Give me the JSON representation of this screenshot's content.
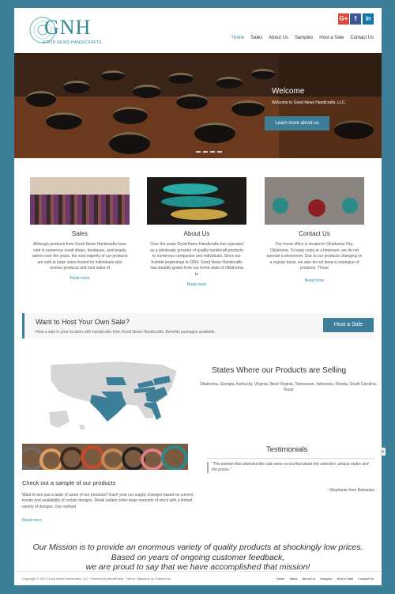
{
  "brand": {
    "logo_text": "GNH",
    "tagline": "GOOD NEWS HANDICRAFTS"
  },
  "social": [
    {
      "icon": "google-plus-icon",
      "glyph": "G+"
    },
    {
      "icon": "facebook-icon",
      "glyph": "f"
    },
    {
      "icon": "linkedin-icon",
      "glyph": "in"
    }
  ],
  "nav": [
    "Home",
    "Sales",
    "About Us",
    "Samples",
    "Host a Sale",
    "Contact Us"
  ],
  "nav_active": "Home",
  "hero": {
    "title": "Welcome",
    "subtitle": "Welcome to Good News Handicrafts, LLC.",
    "button": "Learn more about us"
  },
  "features": [
    {
      "title": "Sales",
      "text": "Although products from Good News Handicrafts have sold in numerous small shops, boutiques, and beauty salons over the years, the vast majority of our products are sold at large sales hosted by individuals who receive products and host sales of",
      "more": "Read more"
    },
    {
      "title": "About Us",
      "text": "Over the years Good News Handicrafts has operated as a wholesale provider of quality handicraft products to numerous companies and individuals.  Since our humble beginnings in 2004, Good News Handicrafts has steadily grown from our home state of Oklahoma to",
      "more": "Read more"
    },
    {
      "title": "Contact Us",
      "text": "Our home office is located in Oklahoma City, Oklahoma.  To keep costs at a minimum, we do not operate a showroom.  Due to our products changing on a regular basis, we also do not keep a catalogue of products.  Those",
      "more": "Read more"
    }
  ],
  "cta": {
    "title": "Want to Host Your Own Sale?",
    "text": "Host a sale in your location with handicrafts from Good News Handicrafts. Benefits packages available.",
    "button": "Host a Sale"
  },
  "states": {
    "title": "States Where our Products are Selling",
    "list": "Oklahoma, Georgia, Kentucky, Virginia, West Virginia, Tennessee, Nebraska, Florida, South Carolina, Texas"
  },
  "sample": {
    "title": "Check out a sample of our products",
    "text": "Want to see just a taste of some of our products?  Each year our supply changes based on current trends and availability of certain designs.  Retail outlets order large amounts of stock with a limited variety of designs.  Our method",
    "more": "Read more"
  },
  "testimonials": {
    "title": "Testimonials",
    "quote": "\"The women that attended the sale were so excited about the selection, unique styles and the prices.\"",
    "author": "~ Stephanie from Nebraska"
  },
  "mission": [
    "Our Mission is to provide an enormous variety of quality products at shockingly low prices.",
    "Based on years of ongoing customer feedback,",
    "we are proud to say that we have accomplished that mission!"
  ],
  "footer": {
    "copyright": "Copyright © 2017 Good News Handicrafts, LLC. Powered by WordPress. Theme: Spacious by ThemeGrill.",
    "nav": [
      "Home",
      "Sales",
      "About Us",
      "Samples",
      "Host a Sale",
      "Contact Us"
    ]
  },
  "colors": {
    "accent": "#3d7f98",
    "link": "#2f8aa9",
    "highlight_state": "#3d7f98",
    "other_state": "#d6d6d6"
  }
}
